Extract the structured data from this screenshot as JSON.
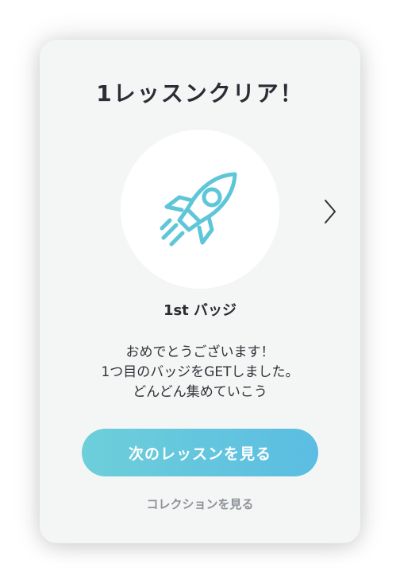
{
  "dialog": {
    "title": "1レッスンクリア！",
    "badge": {
      "icon": "rocket-icon",
      "name": "1st バッジ",
      "icon_color": "#5ec6d8"
    },
    "message_lines": [
      "おめでとうございます！",
      "1つ目のバッジをGETしました。",
      "どんどん集めていこう"
    ],
    "next_icon": "chevron-right-icon",
    "primary_button_label": "次のレッスンを見る",
    "secondary_link_label": "コレクションを見る"
  }
}
